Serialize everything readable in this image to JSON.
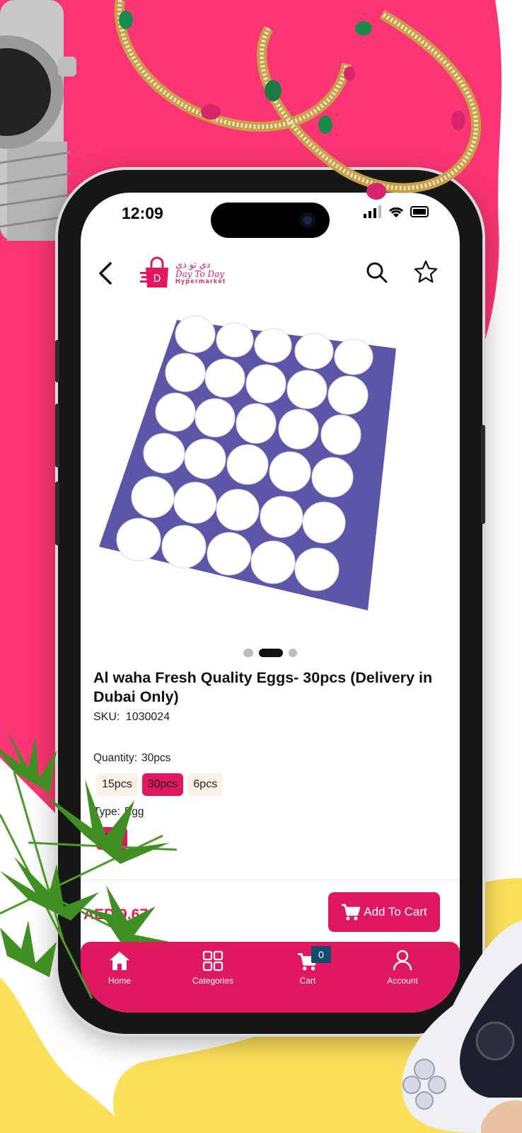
{
  "status_bar": {
    "time": "12:09"
  },
  "header": {
    "logo_arabic": "دي تو دي",
    "logo_script": "Day To Day",
    "logo_sub": "Hypermarket"
  },
  "product": {
    "image_dots": 3,
    "active_dot": 1,
    "title": "Al waha Fresh Quality Eggs- 30pcs (Delivery in Dubai Only)",
    "sku_label": "SKU:",
    "sku_value": "1030024",
    "quantity_label": "Quantity:",
    "quantity_value": "30pcs",
    "quantity_options": [
      "15pcs",
      "30pcs",
      "6pcs"
    ],
    "type_label": "Type:",
    "type_value": "Egg",
    "type_options": [
      "Egg"
    ],
    "price": "AED 9.67"
  },
  "cart_button": {
    "label": "Add To Cart"
  },
  "bottom_nav": {
    "items": [
      {
        "label": "Home",
        "icon": "home-icon"
      },
      {
        "label": "Categories",
        "icon": "grid-icon"
      },
      {
        "label": "Cart",
        "icon": "cart-icon",
        "badge": "0"
      },
      {
        "label": "Account",
        "icon": "user-icon"
      }
    ]
  },
  "colors": {
    "brand": "#e0185f",
    "background_pink": "#fb3574",
    "background_yellow": "#fde05a",
    "badge": "#154a6e"
  }
}
